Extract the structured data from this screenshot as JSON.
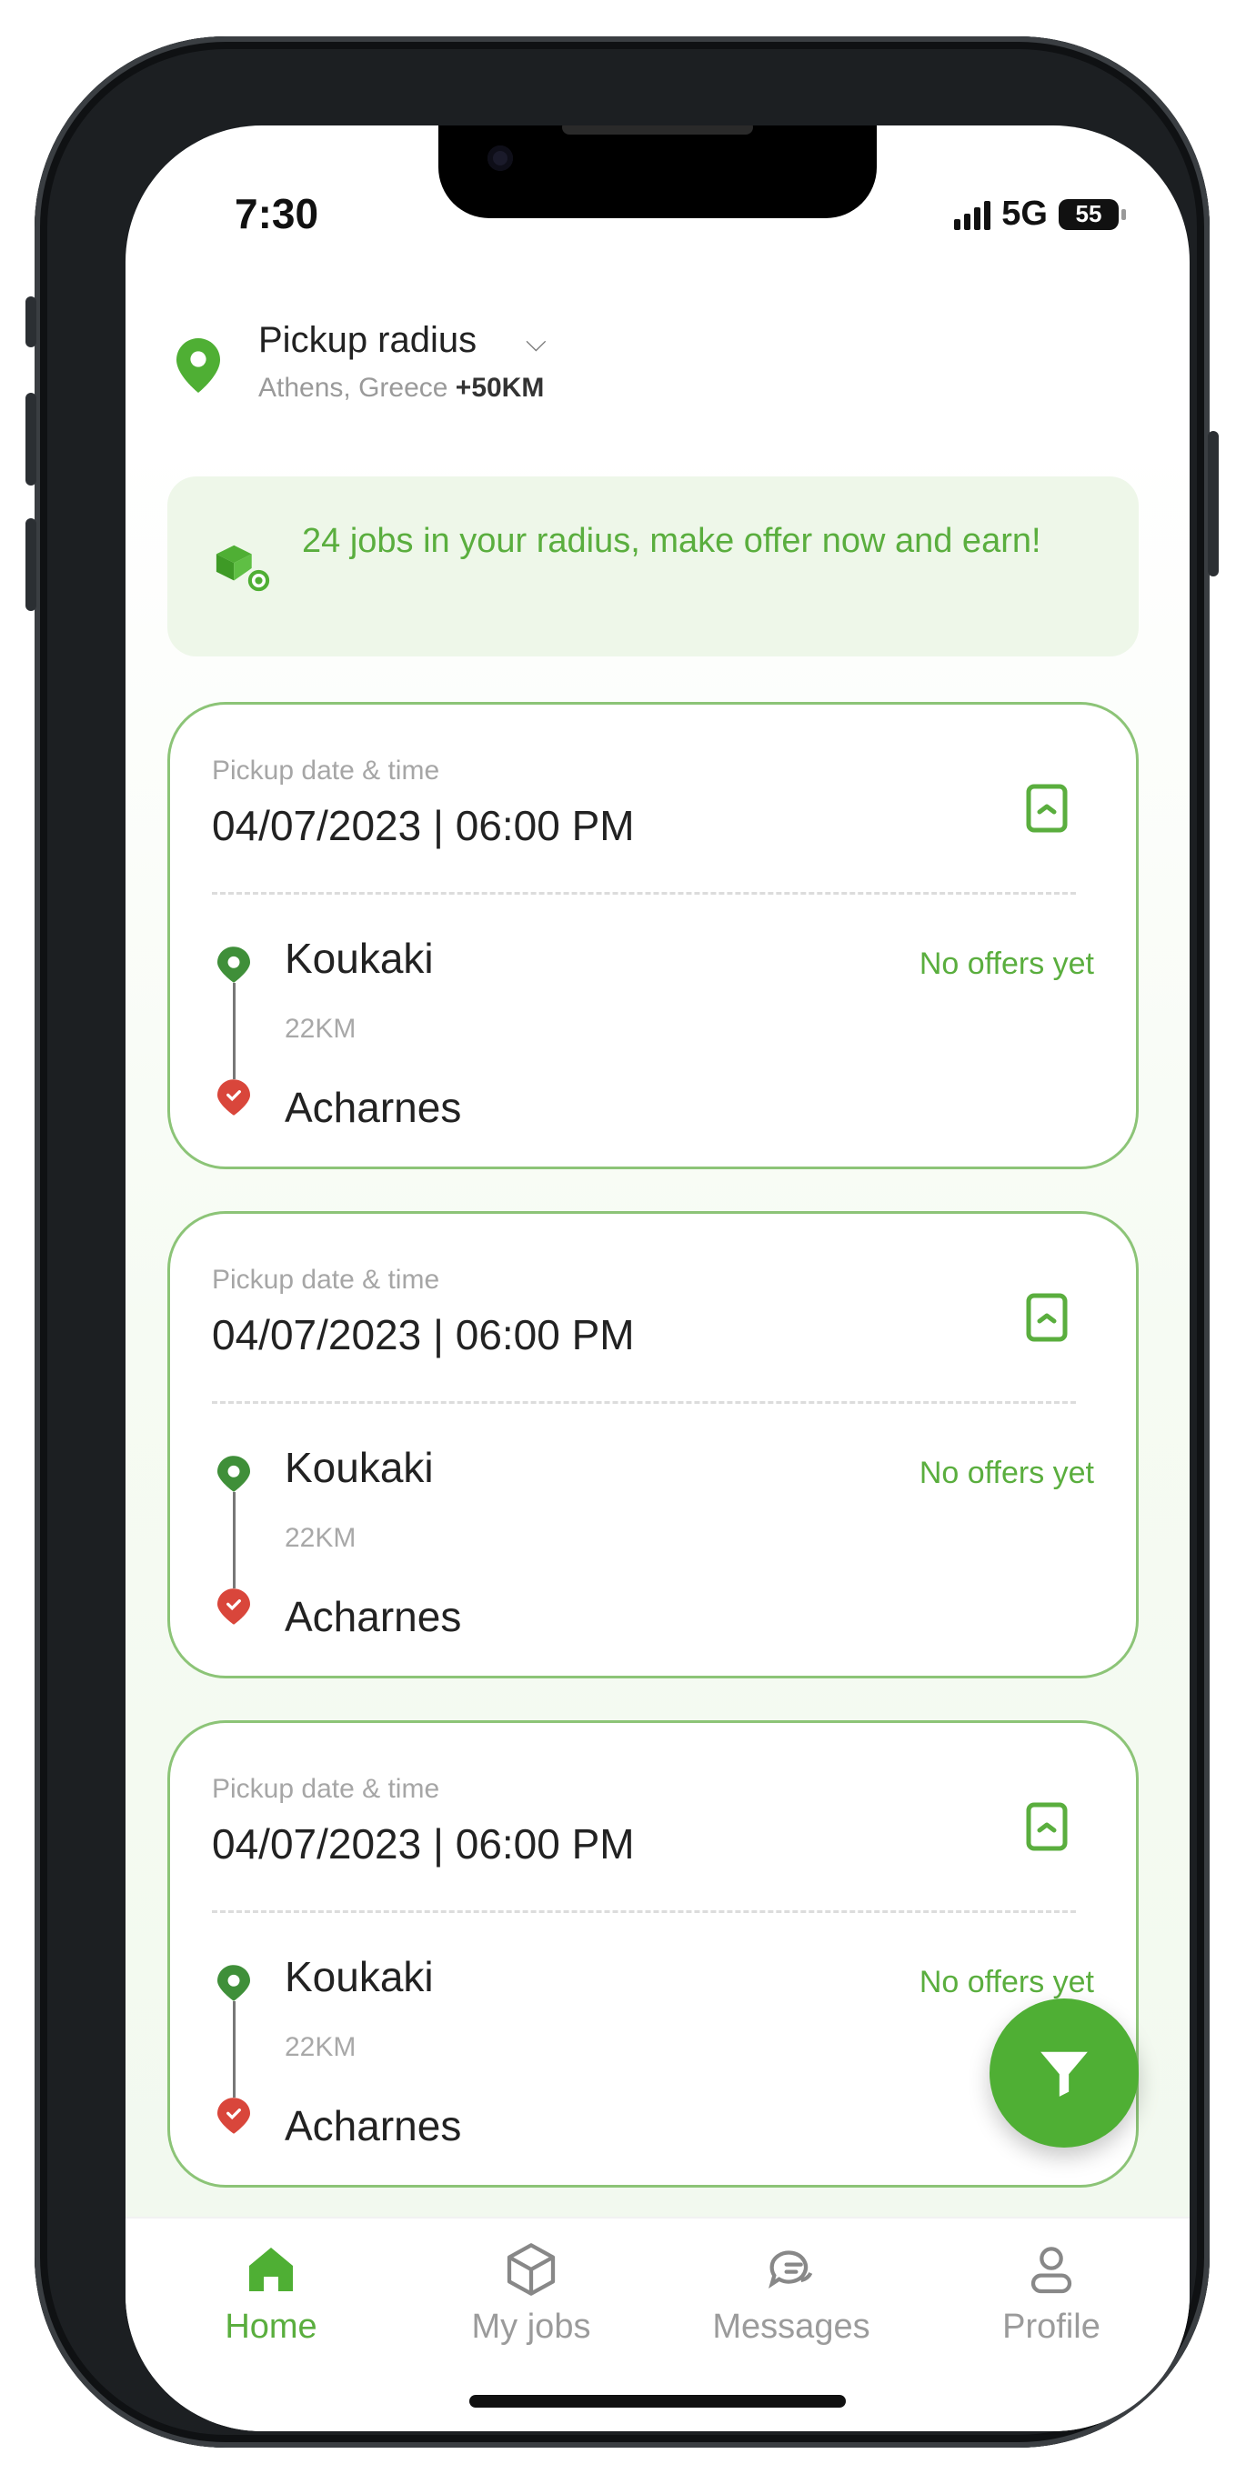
{
  "status_bar": {
    "time": "7:30",
    "network": "5G",
    "battery": "55"
  },
  "header": {
    "title": "Pickup radius",
    "location": "Athens, Greece",
    "radius": "+50KM"
  },
  "banner": {
    "text": "24 jobs in your radius, make offer now and earn!"
  },
  "jobs": [
    {
      "date_label": "Pickup date & time",
      "datetime": "04/07/2023 | 06:00 PM",
      "from": "Koukaki",
      "distance": "22KM",
      "to": "Acharnes",
      "offer_status": "No offers yet"
    },
    {
      "date_label": "Pickup date & time",
      "datetime": "04/07/2023 | 06:00 PM",
      "from": "Koukaki",
      "distance": "22KM",
      "to": "Acharnes",
      "offer_status": "No offers yet"
    },
    {
      "date_label": "Pickup date & time",
      "datetime": "04/07/2023 | 06:00 PM",
      "from": "Koukaki",
      "distance": "22KM",
      "to": "Acharnes",
      "offer_status": "No offers yet"
    }
  ],
  "tabs": [
    {
      "label": "Home",
      "icon": "home-icon",
      "active": true
    },
    {
      "label": "My jobs",
      "icon": "box-icon",
      "active": false
    },
    {
      "label": "Messages",
      "icon": "chat-icon",
      "active": false
    },
    {
      "label": "Profile",
      "icon": "user-icon",
      "active": false
    }
  ],
  "colors": {
    "accent": "#4faf34",
    "accent_text": "#5aae3e",
    "card_border": "#8cc477",
    "banner_bg": "#eef7e9",
    "destination_pin": "#d9463b"
  }
}
